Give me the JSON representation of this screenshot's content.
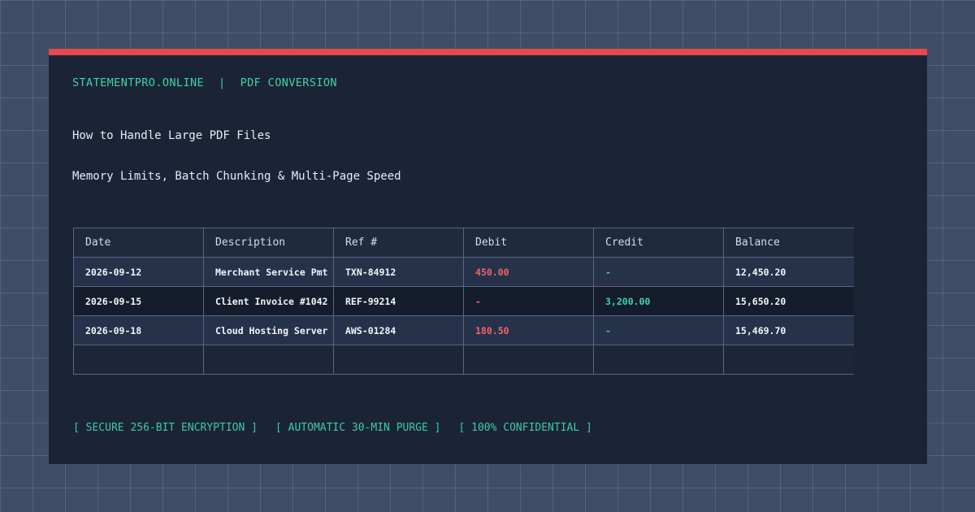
{
  "header": {
    "brand": "STATEMENTPRO.ONLINE",
    "separator": "|",
    "section": "PDF CONVERSION"
  },
  "article": {
    "title": "How to Handle Large PDF Files",
    "subtitle": "Memory Limits, Batch Chunking & Multi-Page Speed"
  },
  "table": {
    "columns": [
      "Date",
      "Description",
      "Ref #",
      "Debit",
      "Credit",
      "Balance"
    ],
    "rows": [
      {
        "date": "2026-09-12",
        "description": "Merchant Service Pmt",
        "ref": "TXN-84912",
        "debit": "450.00",
        "credit": "-",
        "balance": "12,450.20"
      },
      {
        "date": "2026-09-15",
        "description": "Client Invoice #1042",
        "ref": "REF-99214",
        "debit": "-",
        "credit": "3,200.00",
        "balance": "15,650.20"
      },
      {
        "date": "2026-09-18",
        "description": "Cloud Hosting Server",
        "ref": "AWS-01284",
        "debit": "180.50",
        "credit": "-",
        "balance": "15,469.70"
      }
    ]
  },
  "badges": [
    "[ SECURE 256-BIT ENCRYPTION ]",
    "[ AUTOMATIC 30-MIN PURGE ]",
    "[ 100% CONFIDENTIAL ]"
  ],
  "colors": {
    "accent_bar": "#e5484d",
    "brand_text": "#3fd3a8",
    "debit": "#f0646a",
    "credit": "#3fd3a8",
    "card_bg": "#1b2437",
    "page_bg": "#3f4d66"
  }
}
